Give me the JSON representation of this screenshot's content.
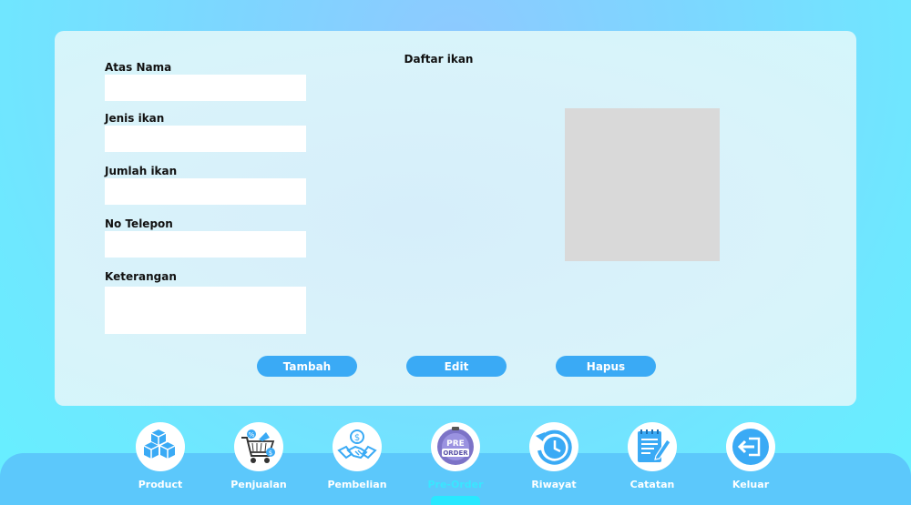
{
  "form": {
    "title": "Daftar ikan",
    "fields": [
      {
        "label": "Atas Nama",
        "value": "",
        "placeholder": ""
      },
      {
        "label": "Jenis ikan",
        "value": "",
        "placeholder": ""
      },
      {
        "label": "Jumlah ikan",
        "value": "",
        "placeholder": ""
      },
      {
        "label": "No Telepon",
        "value": "",
        "placeholder": ""
      },
      {
        "label": "Keterangan",
        "value": "",
        "placeholder": ""
      }
    ],
    "buttons": {
      "add": "Tambah",
      "edit": "Edit",
      "delete": "Hapus"
    }
  },
  "nav": {
    "active": "Pre-Order",
    "items": [
      {
        "label": "Product",
        "icon": "boxes-icon"
      },
      {
        "label": "Penjualan",
        "icon": "shopping-cart-icon"
      },
      {
        "label": "Pembelian",
        "icon": "handshake-money-icon"
      },
      {
        "label": "Pre-Order",
        "icon": "pre-order-badge-icon"
      },
      {
        "label": "Riwayat",
        "icon": "history-icon"
      },
      {
        "label": "Catatan",
        "icon": "notepad-icon"
      },
      {
        "label": "Keluar",
        "icon": "logout-icon"
      }
    ]
  },
  "colors": {
    "accent": "#3aaaf5",
    "active_label": "#39e6ff",
    "bar": "#5cc8fb"
  }
}
